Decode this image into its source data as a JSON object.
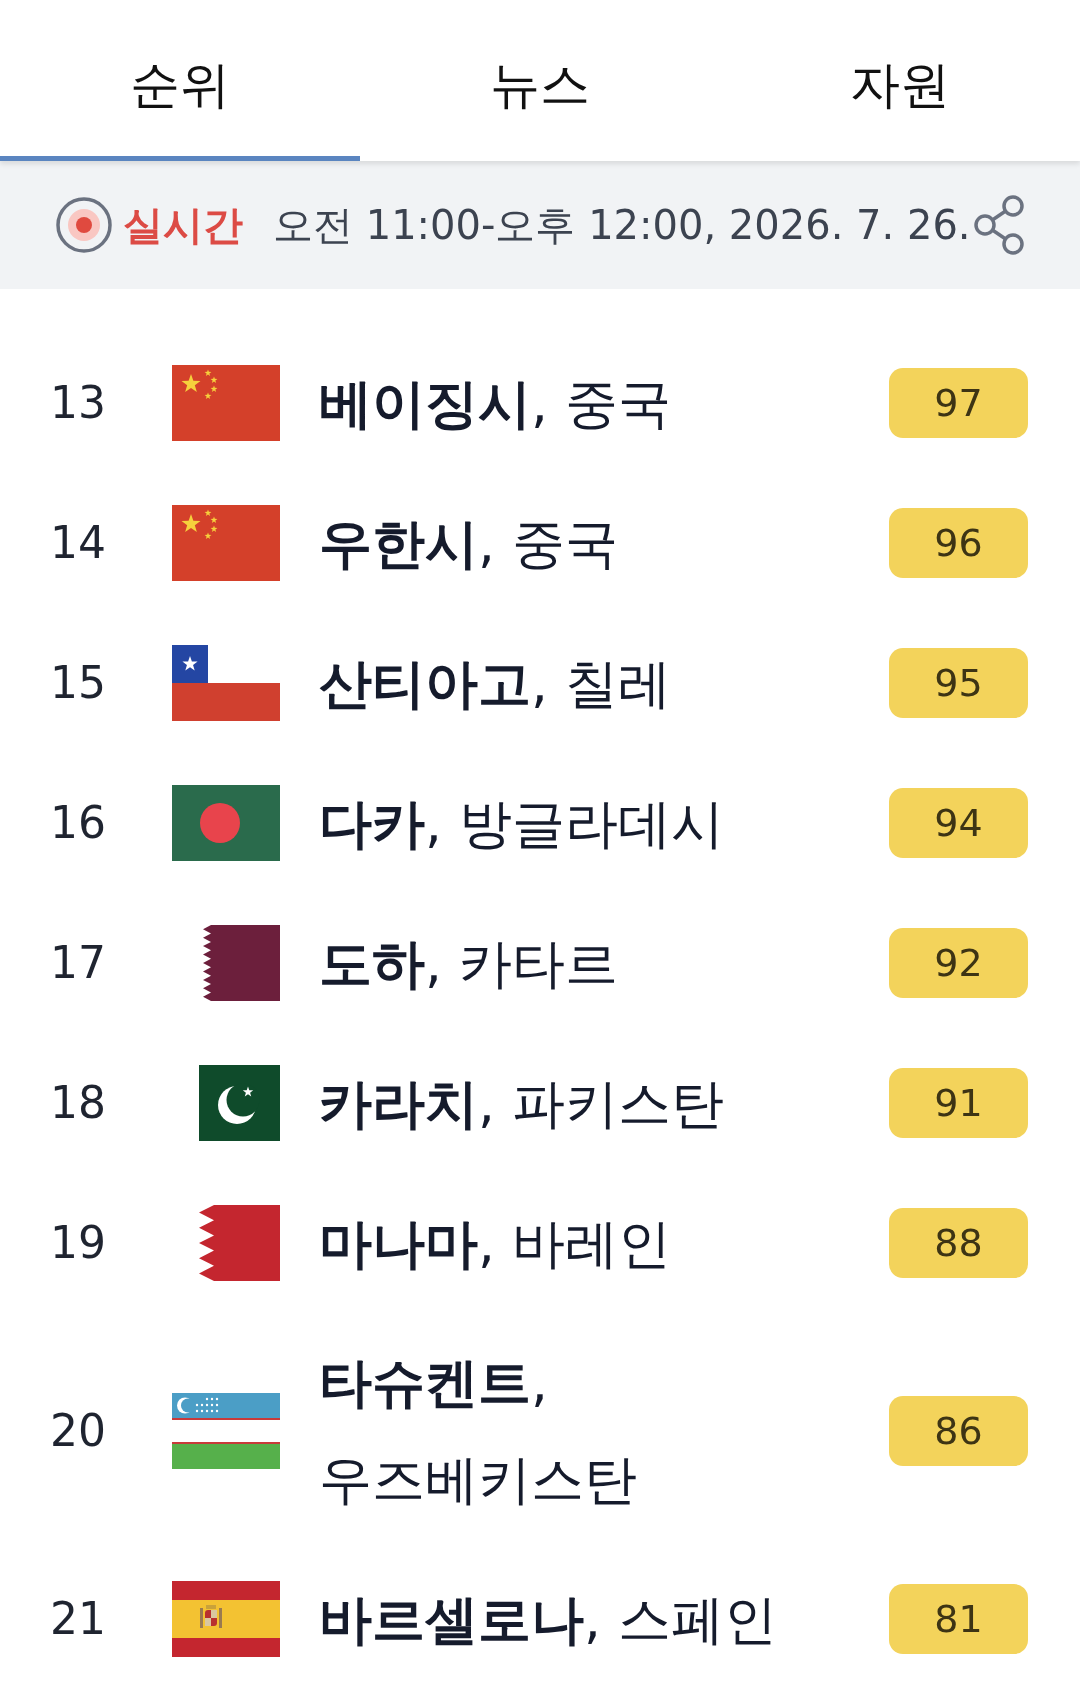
{
  "tabs": [
    {
      "label": "순위",
      "selected": true
    },
    {
      "label": "뉴스",
      "selected": false
    },
    {
      "label": "자원",
      "selected": false
    }
  ],
  "live_bar": {
    "label": "실시간",
    "time_range": "오전 11:00-오후 12:00, 2026. 7. 26."
  },
  "rankings": [
    {
      "rank": "13",
      "kind": "china",
      "name": "**베이징시**, 중국",
      "score": "97"
    },
    {
      "rank": "14",
      "kind": "china",
      "name": "**우한시**, 중국",
      "score": "96"
    },
    {
      "rank": "15",
      "kind": "chile",
      "name": "**산티아고**, 칠레",
      "score": "95"
    },
    {
      "rank": "16",
      "kind": "bangladesh",
      "name": "**다카**, 방글라데시",
      "score": "94"
    },
    {
      "rank": "17",
      "kind": "qatar",
      "name": "**도하**, 카타르",
      "score": "92"
    },
    {
      "rank": "18",
      "kind": "pakistan",
      "name": "**카라치**, 파키스탄",
      "score": "91"
    },
    {
      "rank": "19",
      "kind": "bahrain",
      "name": "**마나마**, 바레인",
      "score": "88"
    },
    {
      "rank": "20",
      "kind": "uzbekistan",
      "name": "**타슈켄트**, 우즈베키스탄",
      "score": "86"
    },
    {
      "rank": "21",
      "kind": "spain",
      "name": "**바르셀로나**, 스페인",
      "score": "81"
    }
  ]
}
